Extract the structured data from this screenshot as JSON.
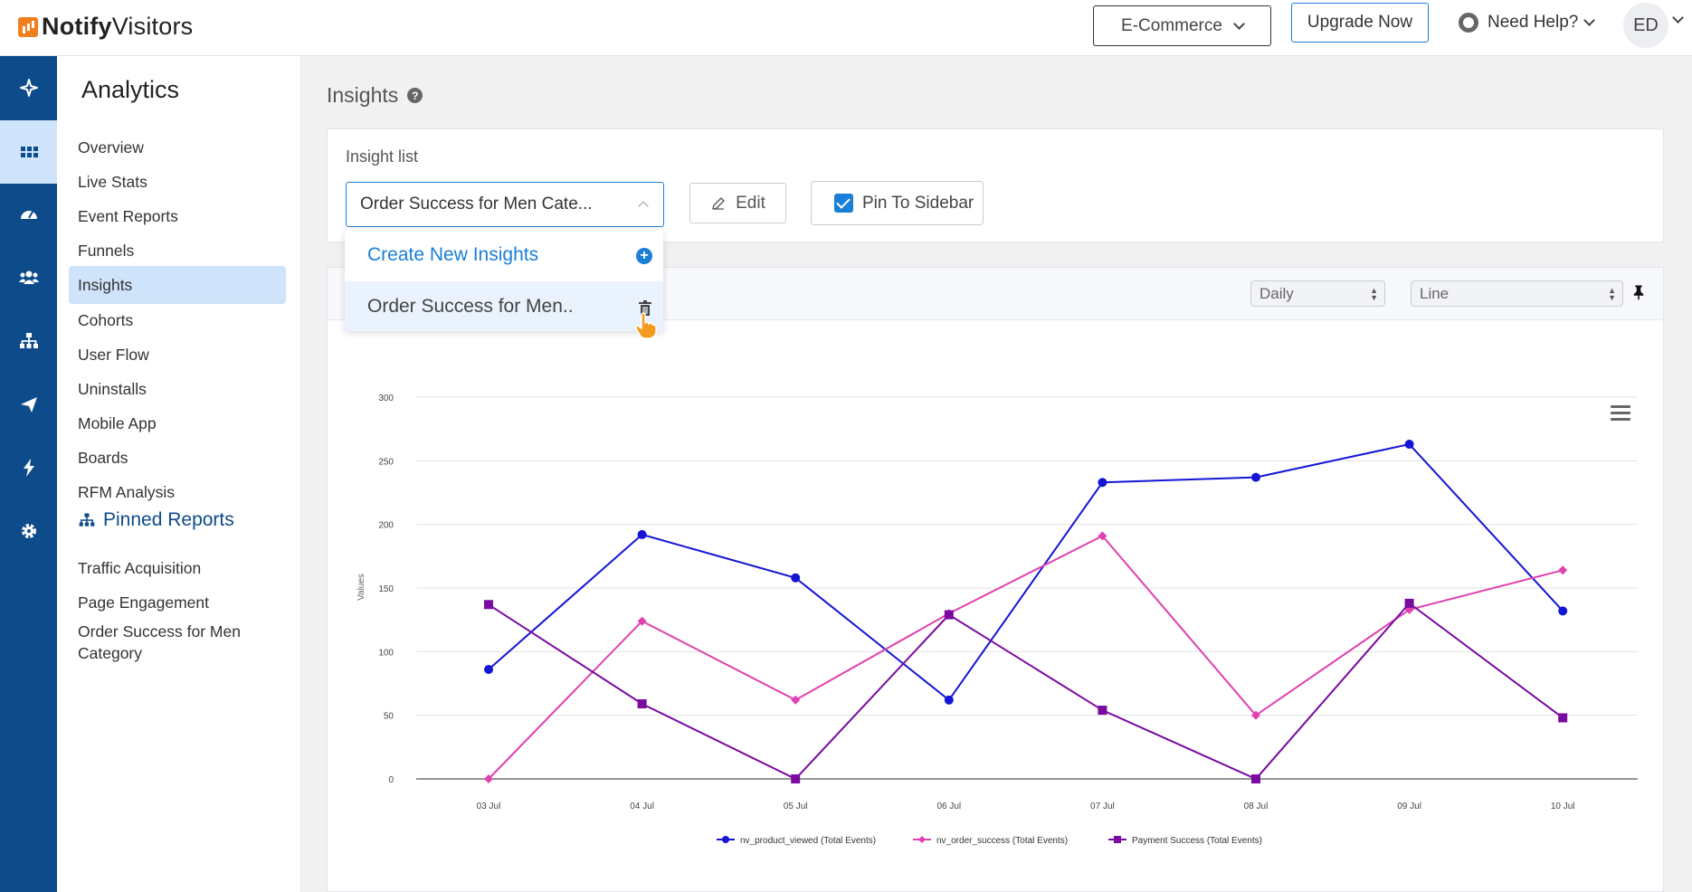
{
  "app": {
    "brand_prefix": "Notify",
    "brand_suffix": "Visitors"
  },
  "header": {
    "project_select": "E-Commerce",
    "upgrade_label": "Upgrade Now",
    "help_label": "Need Help?",
    "avatar_initials": "ED"
  },
  "rail": {
    "icons": [
      "sparkle-icon",
      "grid-icon",
      "dashboard-gauge-icon",
      "users-icon",
      "hierarchy-icon",
      "send-icon",
      "lightning-icon",
      "gear-icon"
    ],
    "active_index": 1
  },
  "sidebar": {
    "title": "Analytics",
    "items": [
      {
        "label": "Overview"
      },
      {
        "label": "Live Stats"
      },
      {
        "label": "Event Reports"
      },
      {
        "label": "Funnels"
      },
      {
        "label": "Insights"
      },
      {
        "label": "Cohorts"
      },
      {
        "label": "User Flow"
      },
      {
        "label": "Uninstalls"
      },
      {
        "label": "Mobile App"
      },
      {
        "label": "Boards"
      },
      {
        "label": "RFM Analysis"
      }
    ],
    "active_item": "Insights",
    "pinned_title": "Pinned Reports",
    "pinned_items": [
      {
        "label": "Traffic Acquisition"
      },
      {
        "label": "Page Engagement"
      },
      {
        "label": "Order Success for Men Category"
      }
    ]
  },
  "main": {
    "title": "Insights",
    "insight_list_label": "Insight list",
    "selected_insight": "Order Success for Men Cate...",
    "edit_label": "Edit",
    "pin_label": "Pin To Sidebar",
    "pin_checked": true,
    "dropdown": {
      "create_label": "Create New Insights",
      "items": [
        "Order Success for Men.."
      ]
    },
    "chart_controls": {
      "interval": "Daily",
      "chart_type": "Line"
    }
  },
  "colors": {
    "accent": "#1a7fd6",
    "rail_bg": "#0d4b8a",
    "active_bg": "#cfe3fb"
  },
  "chart_data": {
    "type": "line",
    "ylabel": "Values",
    "xlabel": "",
    "ylim": [
      0,
      300
    ],
    "yticks": [
      0,
      50,
      100,
      150,
      200,
      250,
      300
    ],
    "categories": [
      "03 Jul",
      "04 Jul",
      "05 Jul",
      "06 Jul",
      "07 Jul",
      "08 Jul",
      "09 Jul",
      "10 Jul"
    ],
    "series": [
      {
        "name": "nv_product_viewed (Total Events)",
        "color": "#1515d6",
        "marker": "circle",
        "values": [
          86,
          192,
          158,
          62,
          233,
          237,
          263,
          132
        ]
      },
      {
        "name": "nv_order_success (Total Events)",
        "color": "#e040b0",
        "marker": "diamond",
        "values": [
          0,
          124,
          62,
          130,
          191,
          50,
          133,
          164
        ]
      },
      {
        "name": "Payment Success (Total Events)",
        "color": "#7a0aa0",
        "marker": "square",
        "values": [
          137,
          59,
          0,
          129,
          54,
          0,
          138,
          48
        ]
      }
    ],
    "legend": "bottom"
  }
}
